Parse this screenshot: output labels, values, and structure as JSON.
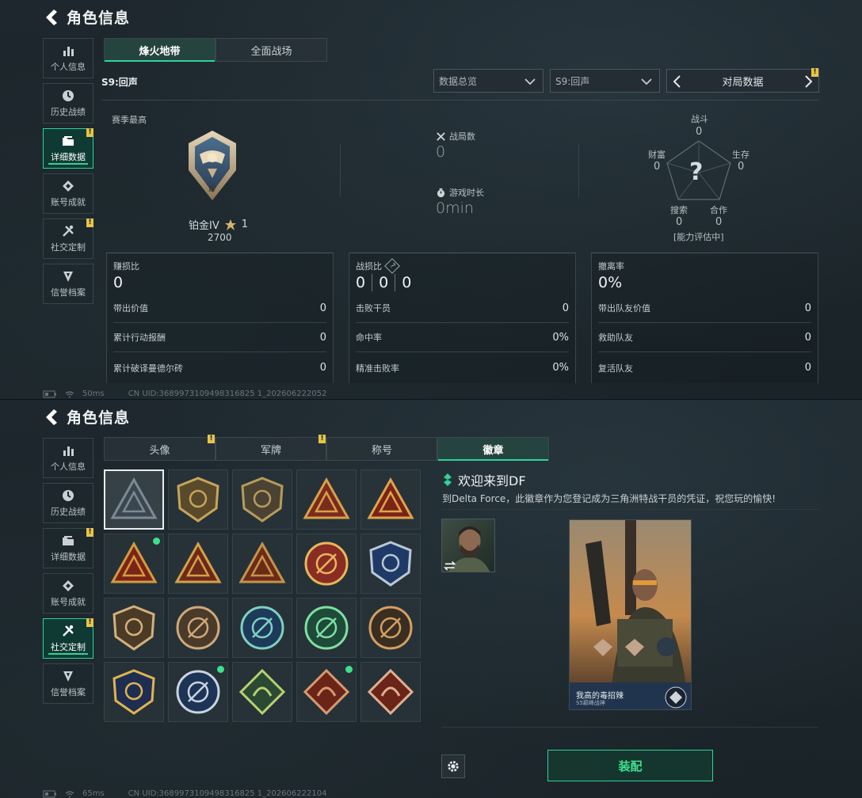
{
  "panel1": {
    "title": "角色信息",
    "nav": [
      {
        "label": "个人信息"
      },
      {
        "label": "历史战绩"
      },
      {
        "label": "详细数据"
      },
      {
        "label": "账号成就"
      },
      {
        "label": "社交定制"
      },
      {
        "label": "信誉档案"
      }
    ],
    "tabs": [
      {
        "label": "烽火地带"
      },
      {
        "label": "全面战场"
      }
    ],
    "season_label": "S9:回声",
    "dropdowns": {
      "overview": "数据总览",
      "season": "S9:回声",
      "match_data": "对局数据"
    },
    "alert_mark": "!",
    "season_high_label": "赛季最高",
    "rank": {
      "name": "铂金IV",
      "stars": "1",
      "score": "2700",
      "numeral": "IV"
    },
    "matches": {
      "label": "战局数",
      "value": "0"
    },
    "playtime": {
      "label": "游戏时长",
      "value": "0min"
    },
    "radar": {
      "combat_label": "战斗",
      "combat_value": "0",
      "wealth_label": "财富",
      "wealth_value": "0",
      "survival_label": "生存",
      "survival_value": "0",
      "search_label": "搜索",
      "search_value": "0",
      "coop_label": "合作",
      "coop_value": "0",
      "status": "[能力评估中]",
      "center_glyph": "?"
    },
    "cards": [
      {
        "head_label": "赚损比",
        "head_value": "0",
        "rows": [
          {
            "label": "带出价值",
            "value": "0"
          },
          {
            "label": "累计行动报酬",
            "value": "0"
          },
          {
            "label": "累计破译曼德尔砖",
            "value": "0"
          }
        ]
      },
      {
        "head_label": "战损比",
        "head_help": "?",
        "head_values": [
          "0",
          "0",
          "0"
        ],
        "rows": [
          {
            "label": "击败干员",
            "value": "0"
          },
          {
            "label": "命中率",
            "value": "0%"
          },
          {
            "label": "精准击败率",
            "value": "0%"
          }
        ]
      },
      {
        "head_label": "撤离率",
        "head_value": "0%",
        "rows": [
          {
            "label": "带出队友价值",
            "value": "0"
          },
          {
            "label": "救助队友",
            "value": "0"
          },
          {
            "label": "复活队友",
            "value": "0"
          }
        ]
      }
    ],
    "footer": {
      "ping": "50ms",
      "uid": "CN UID:3689973109498316825 1_202606222052"
    }
  },
  "panel2": {
    "title": "角色信息",
    "nav": [
      {
        "label": "个人信息"
      },
      {
        "label": "历史战绩"
      },
      {
        "label": "详细数据"
      },
      {
        "label": "账号成就"
      },
      {
        "label": "社交定制"
      },
      {
        "label": "信誉档案"
      }
    ],
    "tabs": [
      {
        "label": "头像"
      },
      {
        "label": "军牌"
      },
      {
        "label": "称号"
      },
      {
        "label": "徽章"
      }
    ],
    "alert_mark": "!",
    "badge_title": "欢迎来到DF",
    "badge_desc": "到Delta Force，此徽章作为您登记成为三角洲特战干员的凭证，祝您玩的愉快!",
    "card_player_name": "我高的毒招辣",
    "card_player_sub": "S5巅峰战神",
    "equip_label": "装配",
    "footer": {
      "ping": "65ms",
      "uid": "CN UID:3689973109498316825 1_202606222104"
    },
    "badges": [
      {
        "icon": "triangle-badge-icon",
        "selected": true,
        "dot": false
      },
      {
        "icon": "helicopter-badge-icon",
        "dot": false
      },
      {
        "icon": "dagger-badge-icon",
        "dot": false
      },
      {
        "icon": "s5-triangle-badge-icon",
        "dot": false
      },
      {
        "icon": "number-one-badge-icon",
        "dot": false
      },
      {
        "icon": "soldier-triangle-badge-icon",
        "dot": true
      },
      {
        "icon": "hexagon-triangle-badge-icon",
        "dot": false
      },
      {
        "icon": "squad-triangle-badge-icon",
        "dot": false
      },
      {
        "icon": "skull-star-badge-icon",
        "dot": false
      },
      {
        "icon": "blue-shield-badge-icon",
        "dot": false
      },
      {
        "icon": "d20-shield-badge-icon",
        "dot": false
      },
      {
        "icon": "gear-emblem-badge-icon",
        "dot": false
      },
      {
        "icon": "blue-crosshair-badge-icon",
        "dot": false
      },
      {
        "icon": "green-crosshair-badge-icon",
        "dot": false
      },
      {
        "icon": "gold-crosshair-badge-icon",
        "dot": false
      },
      {
        "icon": "winged-trident-badge-icon",
        "dot": false
      },
      {
        "icon": "eagle-badge-icon",
        "dot": true
      },
      {
        "icon": "dragon-green-badge-icon",
        "dot": false
      },
      {
        "icon": "dragon-red-badge-icon",
        "dot": true
      },
      {
        "icon": "runner-diamond-badge-icon",
        "dot": false
      }
    ]
  },
  "colors": {
    "accent_green": "#2fd39a",
    "alert_yellow": "#e5c44a",
    "online_dot": "#3ee08c"
  }
}
